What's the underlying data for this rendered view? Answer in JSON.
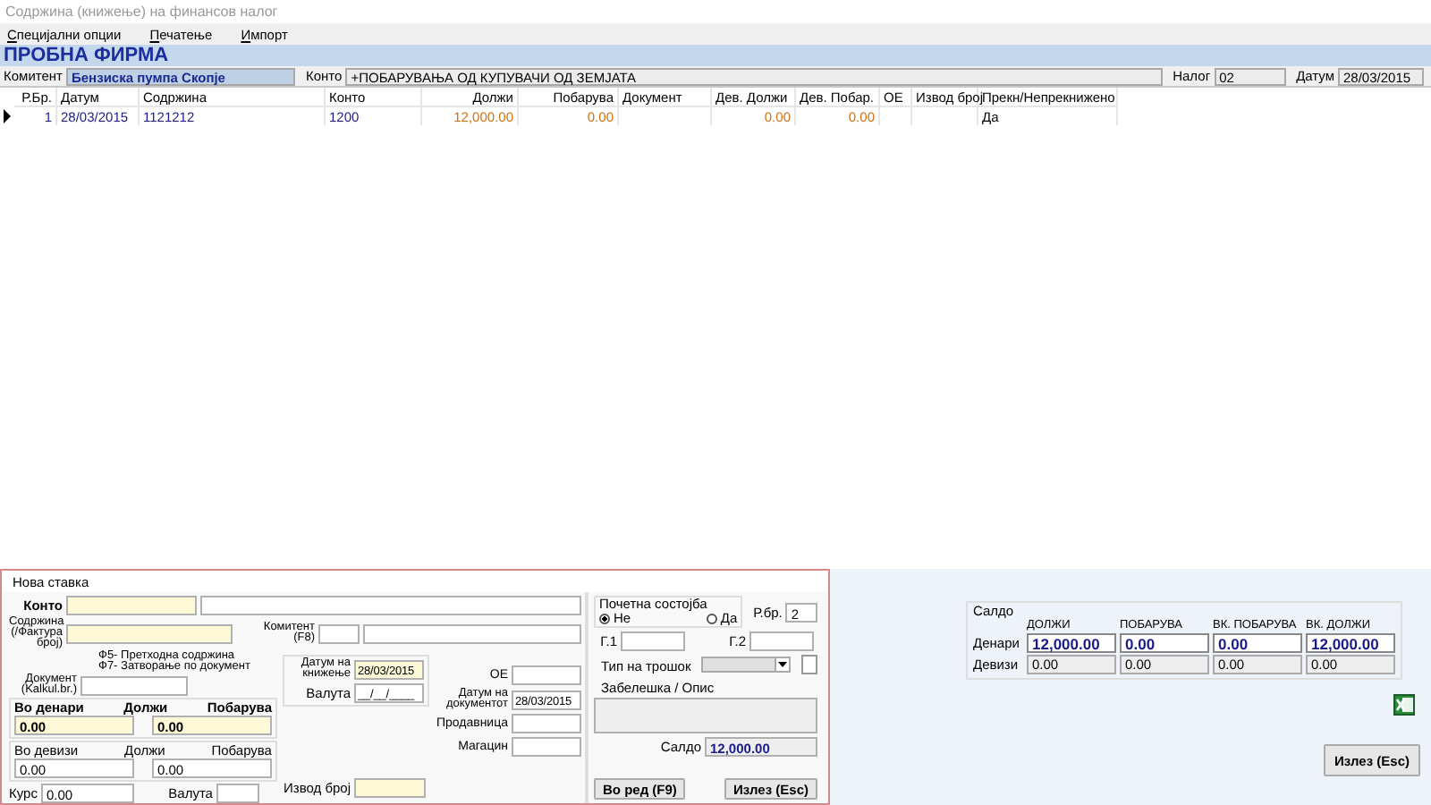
{
  "window": {
    "title": "Содржина (книжење) на финансов налог"
  },
  "menu": [
    "Специјални опции",
    "Печатење",
    "Импорт"
  ],
  "company": "ПРОБНА ФИРМА",
  "filter": {
    "komitent_label": "Комитент",
    "komitent": "Бензиска пумпа Скопје",
    "konto_label": "Конто",
    "konto": "+ПОБАРУВАЊА ОД КУПУВАЧИ ОД ЗЕМЈАТА",
    "nalog_label": "Налог",
    "nalog": "02",
    "datum_label": "Датум",
    "datum": "28/03/2015"
  },
  "table": {
    "columns": [
      "Р.Бр.",
      "Датум",
      "Содржина",
      "Конто",
      "Должи",
      "Побарува",
      "Документ",
      "Дев. Должи",
      "Дев. Побар.",
      "ОЕ",
      "Извод број",
      "Прекн/Непрекнижено"
    ],
    "rows": [
      {
        "selected": true,
        "cells": [
          "1",
          "28/03/2015",
          "1121212",
          "1200",
          "12,000.00",
          "0.00",
          null,
          "0.00",
          "0.00",
          null,
          null,
          "Да"
        ]
      }
    ]
  },
  "entry_form": {
    "title": "Нова ставка",
    "konto": {
      "label": "Конто"
    },
    "content": {
      "label": "Содржина (/Фактура број)"
    },
    "partner": {
      "label": "Комитент (F8)"
    },
    "hints": [
      "Ф5- Претходна содржина",
      "Ф7- Затворање по документ"
    ],
    "document": {
      "label": "Документ (Kalkul.br.)"
    },
    "denars": {
      "title": "Во денари",
      "debit_label": "Должи",
      "credit_label": "Побарува",
      "debit": "0.00",
      "credit": "0.00"
    },
    "foreign": {
      "title": "Во девизи",
      "debit_label": "Должи",
      "credit_label": "Побарува",
      "debit": "0.00",
      "credit": "0.00"
    },
    "rate": {
      "label": "Курс",
      "value": "0.00"
    },
    "currency": {
      "label": "Валута"
    },
    "booking_date": {
      "label": "Датум на книжење",
      "value": "28/03/2015"
    },
    "value_date": {
      "label": "Валута",
      "value": "__/__/____"
    },
    "oe": {
      "label": "ОЕ"
    },
    "document_date": {
      "label": "Датум на документот",
      "value": "28/03/2015"
    },
    "store": {
      "label": "Продавница"
    },
    "warehouse": {
      "label": "Магацин"
    },
    "statement": {
      "label": "Извод број"
    },
    "opening": {
      "title": "Почетна состојба",
      "options": [
        {
          "label": "Не",
          "selected": true
        },
        {
          "label": "Да",
          "selected": false
        }
      ]
    },
    "row_no": {
      "label": "Р.бр.",
      "value": "2"
    },
    "g1": {
      "label": "Г.1"
    },
    "g2": {
      "label": "Г.2"
    },
    "cost_type": {
      "label": "Тип на трошок",
      "disabled": true
    },
    "extra_checkbox": {
      "checked": false
    },
    "note": {
      "label": "Забелешка / Опис"
    },
    "balance": {
      "label": "Салдо",
      "value": "12,000.00"
    },
    "buttons": [
      "Во ред (F9)",
      "Излез (Esc)"
    ]
  },
  "balance_panel": {
    "title": "Салдо",
    "columns": [
      "ДОЛЖИ",
      "ПОБАРУВА",
      "ВК. ПОБАРУВА",
      "ВК. ДОЛЖИ"
    ],
    "rows": [
      {
        "label": "Денари",
        "kind": "editable",
        "values": [
          "12,000.00",
          "0.00",
          "0.00",
          "12,000.00"
        ]
      },
      {
        "label": "Девизи",
        "kind": "readonly",
        "values": [
          "0.00",
          "0.00",
          "0.00",
          "0.00"
        ]
      }
    ]
  },
  "exit_button": "Излез (Esc)"
}
